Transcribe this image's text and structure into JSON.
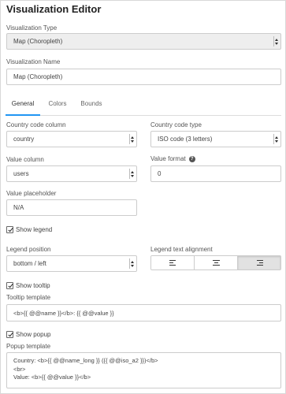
{
  "title": "Visualization Editor",
  "viz_type": {
    "label": "Visualization Type",
    "value": "Map (Choropleth)"
  },
  "viz_name": {
    "label": "Visualization Name",
    "value": "Map (Choropleth)"
  },
  "tabs": [
    {
      "label": "General",
      "active": true
    },
    {
      "label": "Colors",
      "active": false
    },
    {
      "label": "Bounds",
      "active": false
    }
  ],
  "country_code_column": {
    "label": "Country code column",
    "value": "country"
  },
  "country_code_type": {
    "label": "Country code type",
    "value": "ISO code (3 letters)"
  },
  "value_column": {
    "label": "Value column",
    "value": "users"
  },
  "value_format": {
    "label": "Value format",
    "value": "0",
    "help": "?"
  },
  "value_placeholder": {
    "label": "Value placeholder",
    "value": "N/A"
  },
  "show_legend": {
    "label": "Show legend",
    "checked": true
  },
  "legend_position": {
    "label": "Legend position",
    "value": "bottom / left"
  },
  "legend_text_alignment": {
    "label": "Legend text alignment",
    "options": [
      "left",
      "center",
      "right"
    ],
    "selected": "right"
  },
  "show_tooltip": {
    "label": "Show tooltip",
    "checked": true
  },
  "tooltip_template": {
    "label": "Tooltip template",
    "value": "<b>{{ @@name }}</b>: {{ @@value }}"
  },
  "show_popup": {
    "label": "Show popup",
    "checked": true
  },
  "popup_template": {
    "label": "Popup template",
    "value": "Country: <b>{{ @@name_long }} ({{ @@iso_a2 }})</b>\n<br>\nValue: <b>{{ @@value }}</b>"
  },
  "colors": {
    "accent": "#2196f3",
    "border": "#cccccc",
    "disabled_bg": "#eeeeee"
  }
}
